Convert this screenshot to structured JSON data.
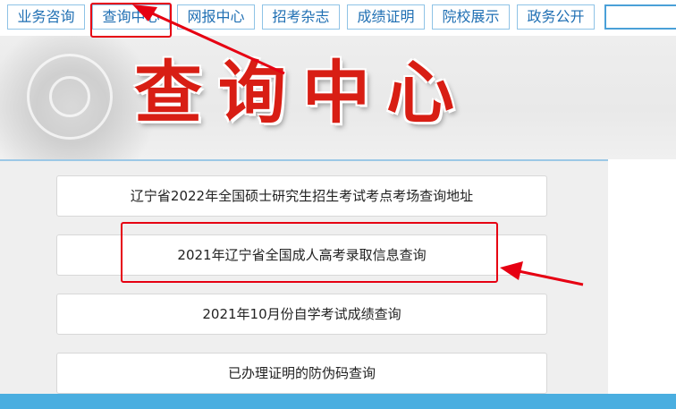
{
  "nav": {
    "items": [
      {
        "label": "业务咨询"
      },
      {
        "label": "查询中心"
      },
      {
        "label": "网报中心"
      },
      {
        "label": "招考杂志"
      },
      {
        "label": "成绩证明"
      },
      {
        "label": "院校展示"
      },
      {
        "label": "政务公开"
      }
    ]
  },
  "hero": {
    "title": "查询中心"
  },
  "queries": [
    {
      "label": "辽宁省2022年全国硕士研究生招生考试考点考场查询地址"
    },
    {
      "label": "2021年辽宁省全国成人高考录取信息查询"
    },
    {
      "label": "2021年10月份自学考试成绩查询"
    },
    {
      "label": "已办理证明的防伪码查询"
    }
  ],
  "colors": {
    "accent": "#1f6fb3",
    "annotation": "#e60012",
    "title": "#d81e14",
    "bottom_bar": "#4aaee0"
  }
}
